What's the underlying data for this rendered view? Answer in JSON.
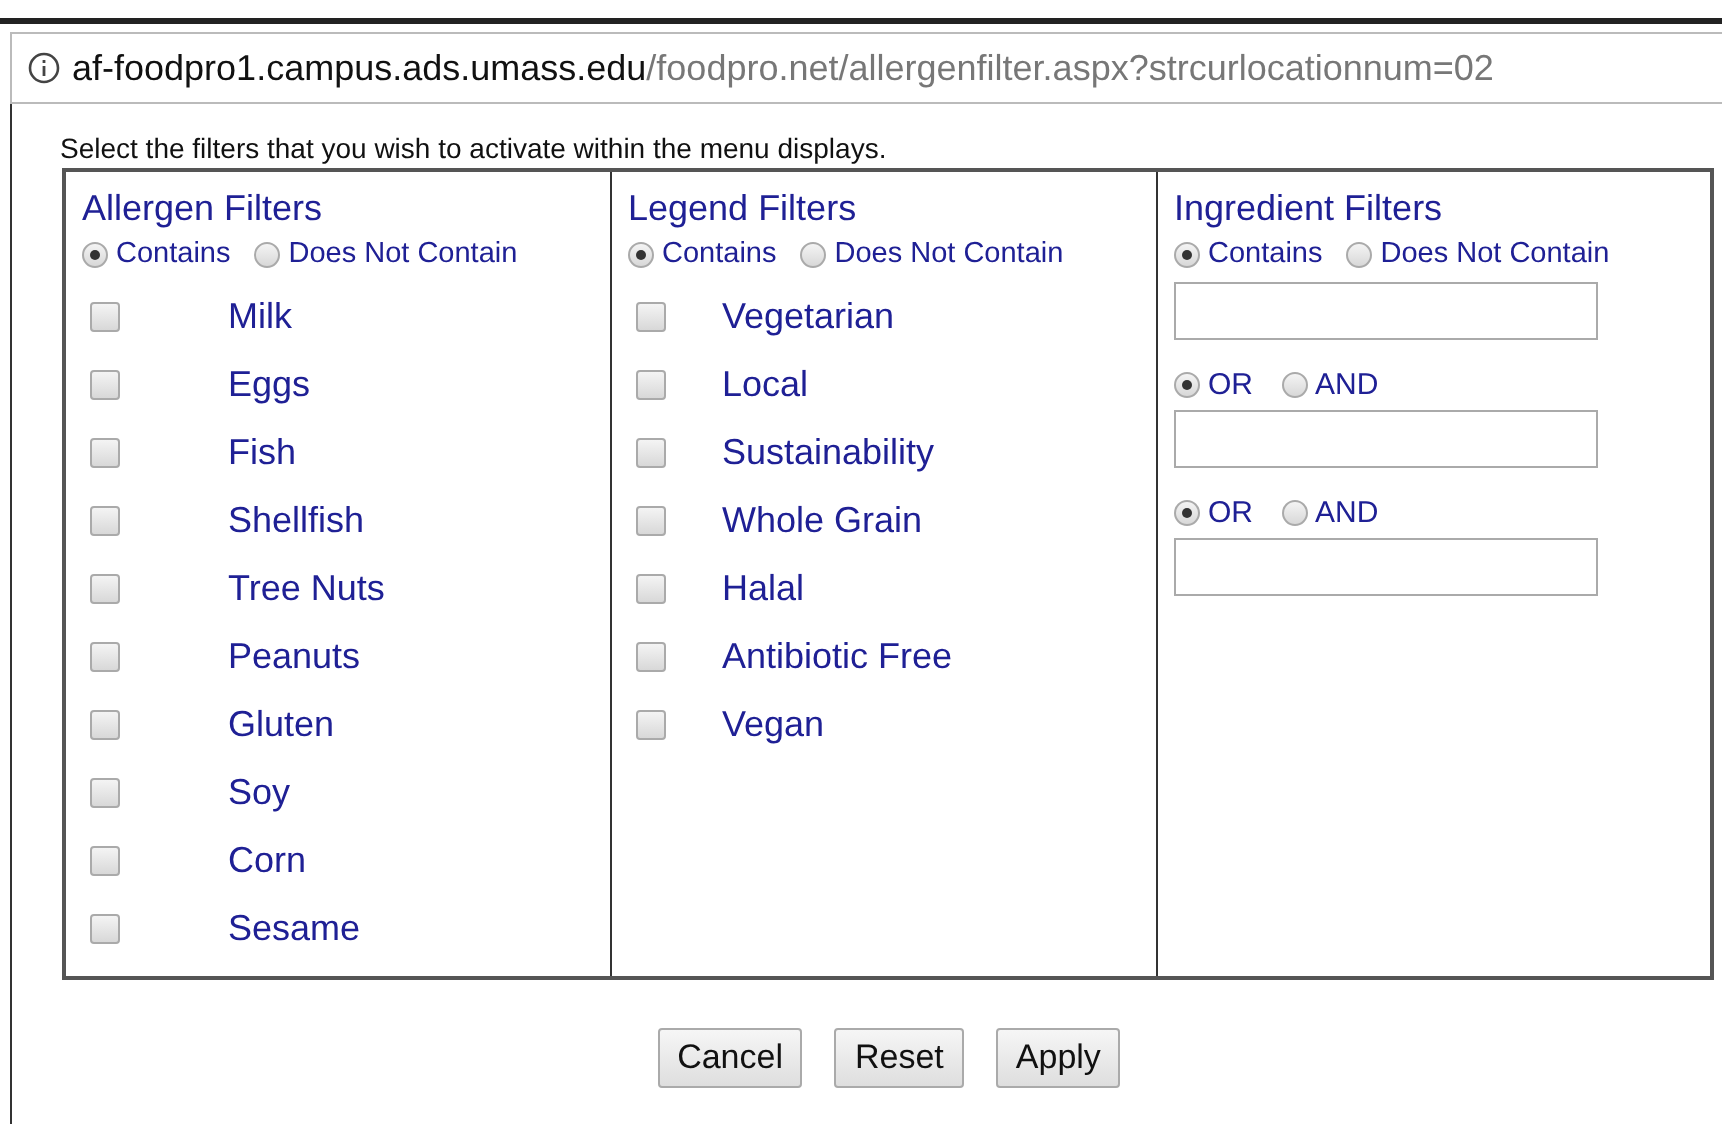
{
  "address_bar": {
    "host": "af-foodpro1.campus.ads.umass.edu",
    "path": "/foodpro.net/allergenfilter.aspx?strcurlocationnum=02"
  },
  "instruction": "Select the filters that you wish to activate within the menu displays.",
  "columns": [
    {
      "kind": "checklist",
      "title": "Allergen Filters",
      "mode_options": [
        {
          "label": "Contains",
          "selected": true
        },
        {
          "label": "Does Not Contain",
          "selected": false
        }
      ],
      "items": [
        {
          "label": "Milk",
          "checked": false
        },
        {
          "label": "Eggs",
          "checked": false
        },
        {
          "label": "Fish",
          "checked": false
        },
        {
          "label": "Shellfish",
          "checked": false
        },
        {
          "label": "Tree Nuts",
          "checked": false
        },
        {
          "label": "Peanuts",
          "checked": false
        },
        {
          "label": "Gluten",
          "checked": false
        },
        {
          "label": "Soy",
          "checked": false
        },
        {
          "label": "Corn",
          "checked": false
        },
        {
          "label": "Sesame",
          "checked": false
        }
      ]
    },
    {
      "kind": "checklist",
      "title": "Legend Filters",
      "mode_options": [
        {
          "label": "Contains",
          "selected": true
        },
        {
          "label": "Does Not Contain",
          "selected": false
        }
      ],
      "items": [
        {
          "label": "Vegetarian",
          "checked": false
        },
        {
          "label": "Local",
          "checked": false
        },
        {
          "label": "Sustainability",
          "checked": false
        },
        {
          "label": "Whole Grain",
          "checked": false
        },
        {
          "label": "Halal",
          "checked": false
        },
        {
          "label": "Antibiotic Free",
          "checked": false
        },
        {
          "label": "Vegan",
          "checked": false
        }
      ]
    },
    {
      "kind": "ingredients",
      "title": "Ingredient Filters",
      "mode_options": [
        {
          "label": "Contains",
          "selected": true
        },
        {
          "label": "Does Not Contain",
          "selected": false
        }
      ],
      "rows": [
        {
          "kind": "field"
        },
        {
          "kind": "connector",
          "options": [
            {
              "label": "OR",
              "selected": true
            },
            {
              "label": "AND",
              "selected": false
            }
          ]
        },
        {
          "kind": "field"
        },
        {
          "kind": "connector",
          "options": [
            {
              "label": "OR",
              "selected": true
            },
            {
              "label": "AND",
              "selected": false
            }
          ]
        },
        {
          "kind": "field"
        }
      ]
    }
  ],
  "buttons": [
    "Cancel",
    "Reset",
    "Apply"
  ]
}
